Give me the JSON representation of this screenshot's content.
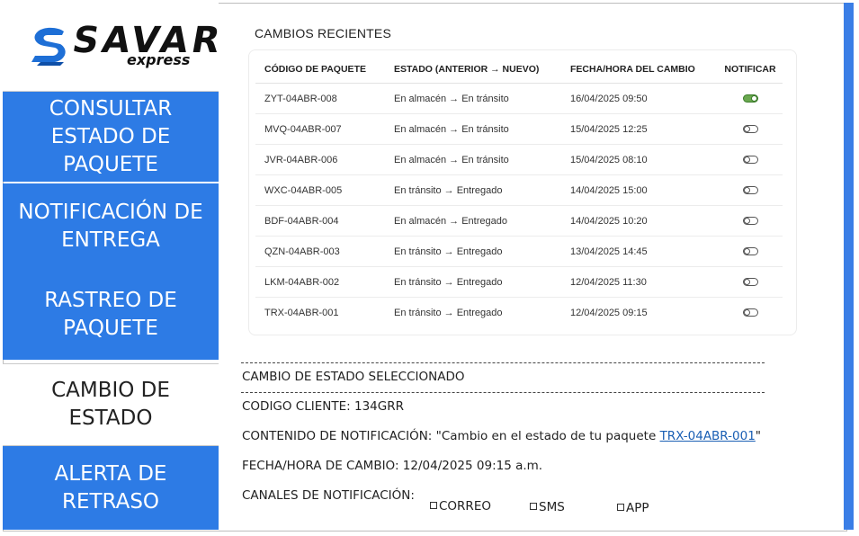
{
  "brand": {
    "name": "SAVAR",
    "sub": "express"
  },
  "sidebar": {
    "items": [
      {
        "label": "CONSULTAR ESTADO DE PAQUETE"
      },
      {
        "label": "NOTIFICACIÓN DE ENTREGA"
      },
      {
        "label": "RASTREO DE PAQUETE"
      },
      {
        "label": "CAMBIO DE ESTADO",
        "active": true
      },
      {
        "label": "ALERTA DE RETRASO"
      }
    ]
  },
  "recent": {
    "title": "CAMBIOS RECIENTES",
    "headers": [
      "CÓDIGO DE PAQUETE",
      "ESTADO (ANTERIOR → NUEVO)",
      "FECHA/HORA DEL CAMBIO",
      "NOTIFICAR"
    ],
    "rows": [
      {
        "code": "ZYT-04ABR-008",
        "status": "En almacén → En tránsito",
        "datetime": "16/04/2025 09:50",
        "notify": true
      },
      {
        "code": "MVQ-04ABR-007",
        "status": "En almacén → En tránsito",
        "datetime": "15/04/2025 12:25",
        "notify": false
      },
      {
        "code": "JVR-04ABR-006",
        "status": "En almacén → En tránsito",
        "datetime": "15/04/2025 08:10",
        "notify": false
      },
      {
        "code": "WXC-04ABR-005",
        "status": "En tránsito → Entregado",
        "datetime": "14/04/2025 15:00",
        "notify": false
      },
      {
        "code": "BDF-04ABR-004",
        "status": "En almacén → Entregado",
        "datetime": "14/04/2025 10:20",
        "notify": false
      },
      {
        "code": "QZN-04ABR-003",
        "status": "En tránsito → Entregado",
        "datetime": "13/04/2025 14:45",
        "notify": false
      },
      {
        "code": "LKM-04ABR-002",
        "status": "En tránsito → Entregado",
        "datetime": "12/04/2025 11:30",
        "notify": false
      },
      {
        "code": "TRX-04ABR-001",
        "status": "En tránsito → Entregado",
        "datetime": "12/04/2025 09:15",
        "notify": false
      }
    ]
  },
  "selected": {
    "title": "CAMBIO DE ESTADO SELECCIONADO",
    "client": "CODIGO CLIENTE: 134GRR",
    "content_prefix": "CONTENIDO DE NOTIFICACIÓN: \"Cambio en el estado de tu paquete ",
    "content_link": "TRX-04ABR-001",
    "content_suffix": "\"",
    "datetime": "FECHA/HORA DE CAMBIO: 12/04/2025 09:15 a.m.",
    "channels_label": "CANALES DE NOTIFICACIÓN:",
    "channels": [
      "CORREO",
      "SMS",
      "APP"
    ]
  },
  "colors": {
    "accent": "#2d7be5",
    "toggle_on": "#6aa84f",
    "link": "#1a5fb4"
  },
  "icons": {
    "logo": "savar-s-logo-icon"
  }
}
